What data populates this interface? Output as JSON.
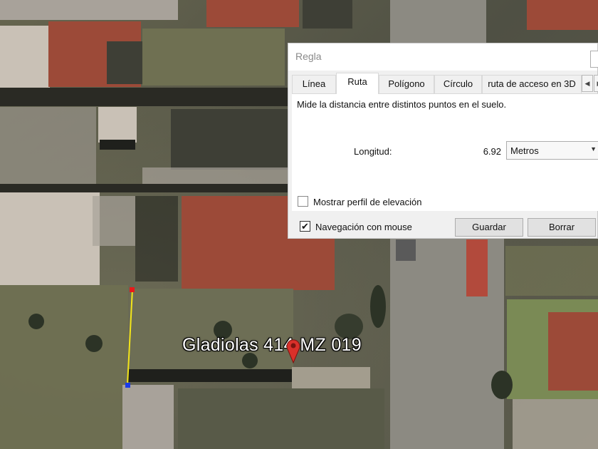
{
  "map": {
    "placemark_label": "Gladiolas 414-MZ 019",
    "colors": {
      "measure_line": "#f3e51a",
      "start_point": "#e8191a",
      "end_point": "#1a3be8",
      "pin": "#d9302a"
    }
  },
  "ruler": {
    "title": "Regla",
    "tabs": [
      {
        "label": "Línea",
        "active": false
      },
      {
        "label": "Ruta",
        "active": true
      },
      {
        "label": "Polígono",
        "active": false
      },
      {
        "label": "Círculo",
        "active": false
      },
      {
        "label": "ruta de acceso en 3D",
        "active": false
      }
    ],
    "description": "Mide la distancia entre distintos puntos en el suelo.",
    "length_label": "Longitud:",
    "length_value": "6.92",
    "unit": "Metros",
    "elevation_checkbox": {
      "label": "Mostrar perfil de elevación",
      "checked": false
    },
    "mouse_nav_checkbox": {
      "label": "Navegación con mouse",
      "checked": true
    },
    "save_button": "Guardar",
    "clear_button": "Borrar"
  }
}
